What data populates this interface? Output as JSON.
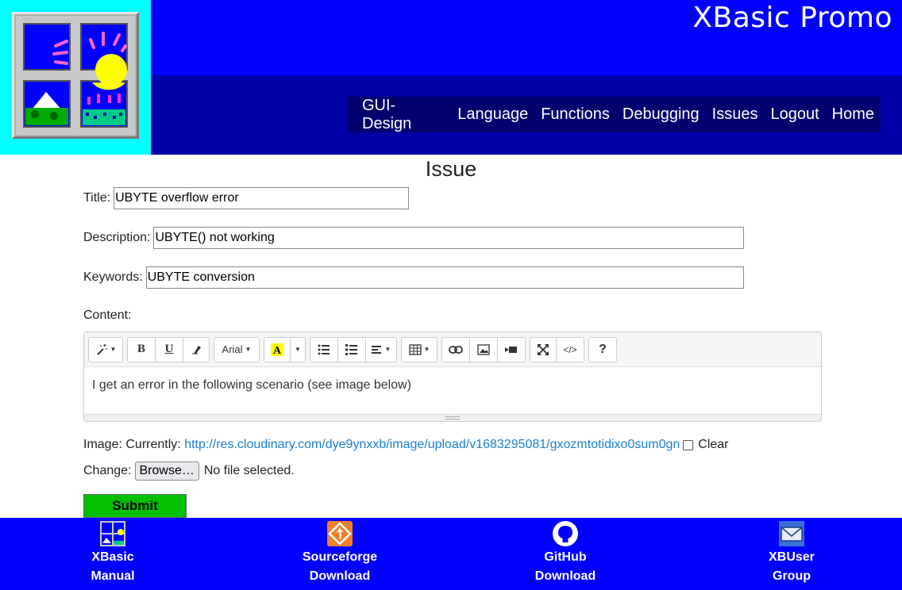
{
  "header": {
    "site_title": "XBasic Promo",
    "nav": [
      "GUI-Design",
      "Language",
      "Functions",
      "Debugging",
      "Issues",
      "Logout",
      "Home"
    ]
  },
  "main": {
    "page_title": "Issue",
    "title_label": "Title:",
    "title_value": "UBYTE overflow error",
    "description_label": "Description:",
    "description_value": "UBYTE() not working",
    "keywords_label": "Keywords:",
    "keywords_value": "UBYTE conversion",
    "content_label": "Content:",
    "editor": {
      "font_name": "Arial",
      "bold": "B",
      "underline": "U",
      "help": "?",
      "codeview": "</>",
      "content": "I get an error in the following scenario (see image below)"
    },
    "image_label": "Image:",
    "currently_label": "Currently:",
    "image_url": "http://res.cloudinary.com/dye9ynxxb/image/upload/v1683295081/gxozmtotidixo0sum0gn",
    "clear_label": "Clear",
    "change_label": "Change:",
    "browse_label": "Browse…",
    "no_file_label": "No file selected.",
    "submit_label": "Submit"
  },
  "footer": {
    "items": [
      {
        "line1": "XBasic",
        "line2": "Manual",
        "icon": "xbasic-logo-icon"
      },
      {
        "line1": "Sourceforge",
        "line2": "Download",
        "icon": "sourceforge-icon"
      },
      {
        "line1": "GitHub",
        "line2": "Download",
        "icon": "github-icon"
      },
      {
        "line1": "XBUser",
        "line2": "Group",
        "icon": "mail-icon"
      }
    ]
  },
  "colors": {
    "header_blue": "#0000ff",
    "header_dark_blue": "#0000a8",
    "logo_bg": "#00ffff",
    "submit_green": "#00c000",
    "link_blue": "#1a7fd0"
  }
}
